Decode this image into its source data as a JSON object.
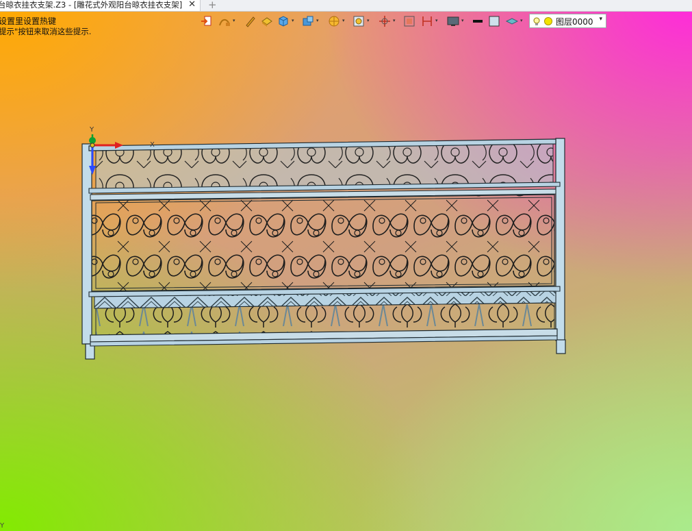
{
  "window": {
    "tab_title": "台晾衣挂衣支架.Z3 - [雕花式外观阳台晾衣挂衣支架]",
    "tab_close": "✕",
    "new_tab": "+"
  },
  "hints": {
    "line1": "设置里设置热键",
    "line2": "提示\"按钮来取消这些提示."
  },
  "toolbar": {
    "icons": [
      "import-icon",
      "sketch-icon",
      "pen-icon",
      "solid-shape-icon",
      "box-icon",
      "shell-icon",
      "render-icon",
      "view-icon",
      "transform-icon",
      "frame-icon",
      "section-icon",
      "display-icon",
      "line-style-icon",
      "color-swatch-icon",
      "layer-stack-icon"
    ],
    "layer_value": "图层0000",
    "layer_dropdown": "▾"
  },
  "axes": {
    "x": "X",
    "y": "Y"
  },
  "corner": "Y",
  "colors": {
    "model_fill": "#b8d3e3",
    "model_stroke": "#1e2a30",
    "axis_x": "#e02020",
    "axis_y": "#2b4bff",
    "axis_origin": "#10a030"
  }
}
